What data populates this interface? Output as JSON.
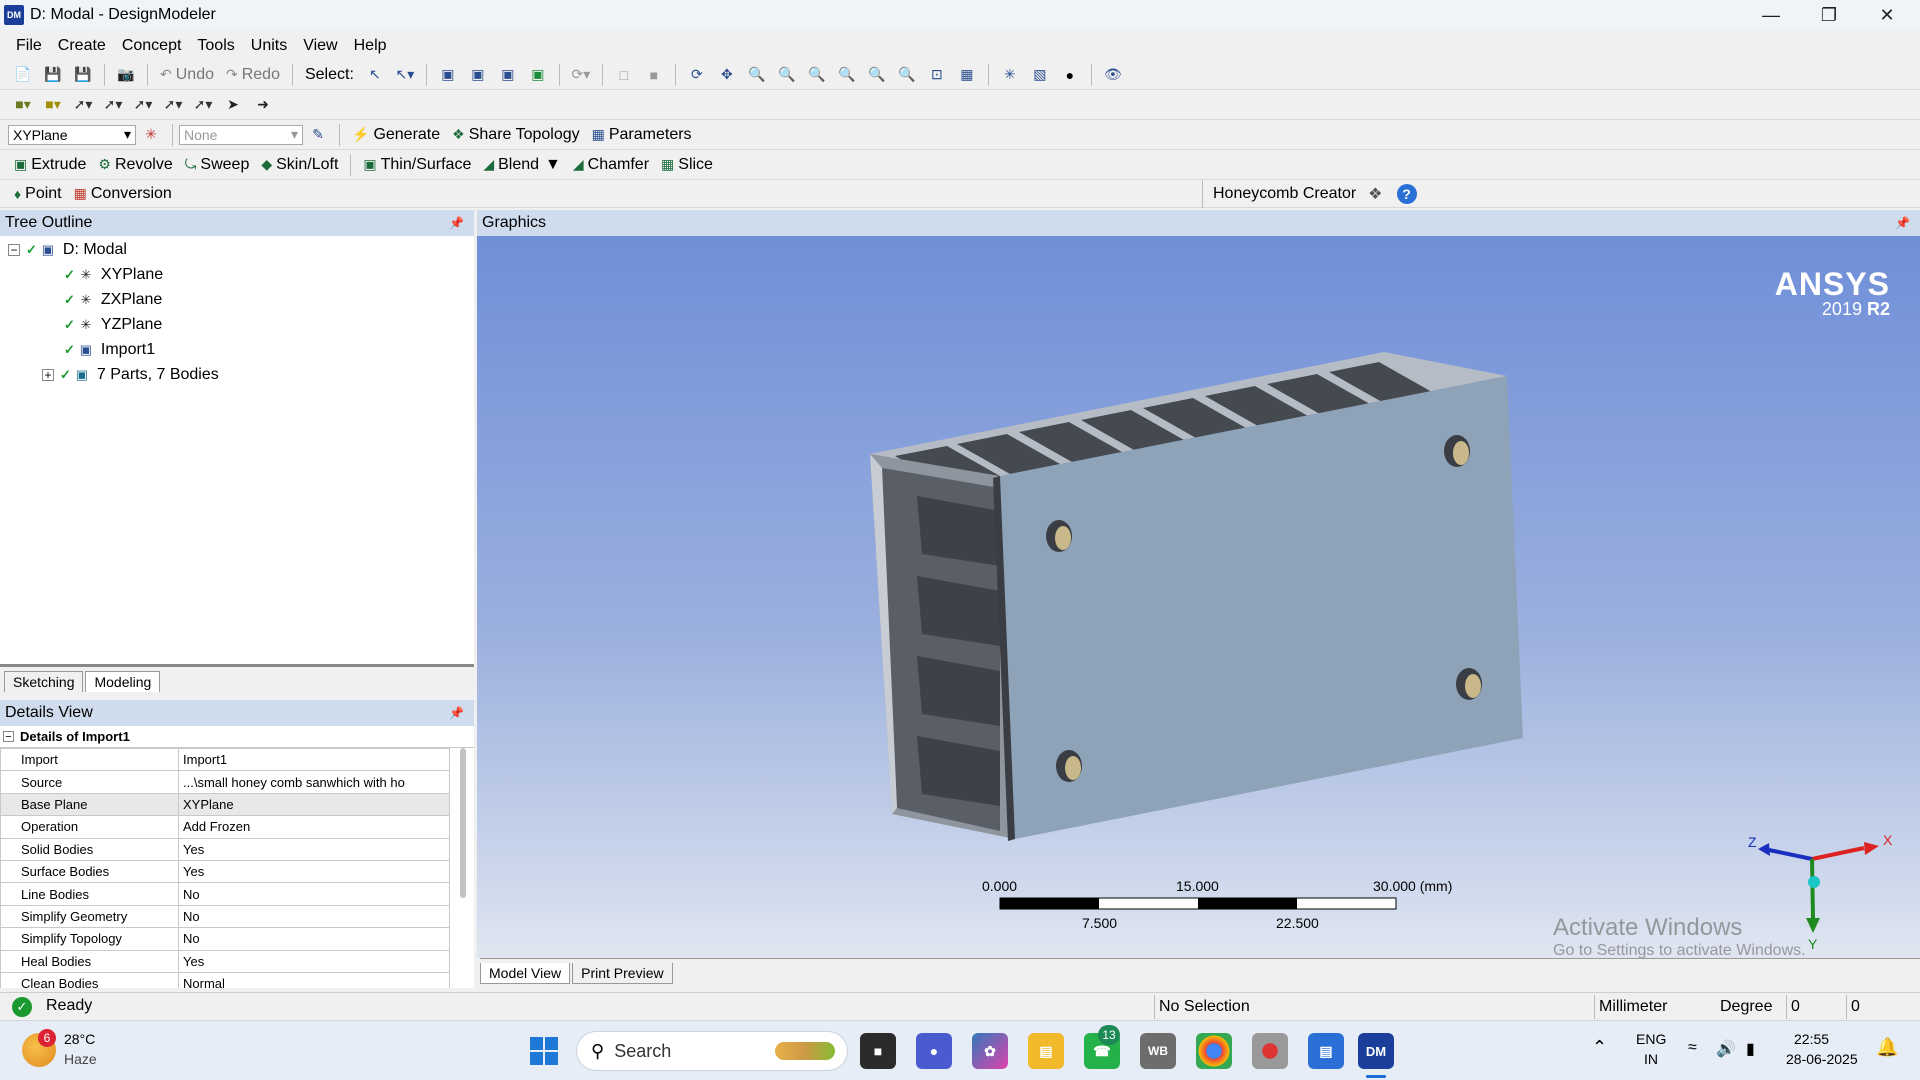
{
  "window": {
    "title": "D: Modal - DesignModeler",
    "app_icon": "DM"
  },
  "menu": [
    "File",
    "Create",
    "Concept",
    "Tools",
    "Units",
    "View",
    "Help"
  ],
  "toolbar1": {
    "undo": "Undo",
    "redo": "Redo",
    "select": "Select:"
  },
  "toolbar3": {
    "plane": "XYPlane",
    "sketch": "None",
    "generate": "Generate",
    "share_topology": "Share Topology",
    "parameters": "Parameters"
  },
  "toolbar4": {
    "extrude": "Extrude",
    "revolve": "Revolve",
    "sweep": "Sweep",
    "skin_loft": "Skin/Loft",
    "thin_surface": "Thin/Surface",
    "blend": "Blend",
    "chamfer": "Chamfer",
    "slice": "Slice"
  },
  "toolbar5": {
    "point": "Point",
    "conversion": "Conversion",
    "honeycomb": "Honeycomb Creator"
  },
  "tree": {
    "header": "Tree Outline",
    "root": "D: Modal",
    "items": [
      "XYPlane",
      "ZXPlane",
      "YZPlane",
      "Import1",
      "7 Parts, 7 Bodies"
    ],
    "tabs": [
      "Sketching",
      "Modeling"
    ]
  },
  "details": {
    "header": "Details View",
    "section": "Details of Import1",
    "rows": [
      [
        "Import",
        "Import1"
      ],
      [
        "Source",
        "...\\small honey comb sanwhich with ho"
      ],
      [
        "Base Plane",
        "XYPlane"
      ],
      [
        "Operation",
        "Add Frozen"
      ],
      [
        "Solid Bodies",
        "Yes"
      ],
      [
        "Surface Bodies",
        "Yes"
      ],
      [
        "Line Bodies",
        "No"
      ],
      [
        "Simplify Geometry",
        "No"
      ],
      [
        "Simplify Topology",
        "No"
      ],
      [
        "Heal Bodies",
        "Yes"
      ],
      [
        "Clean Bodies",
        "Normal"
      ]
    ]
  },
  "graphics": {
    "header": "Graphics",
    "logo_main": "ANSYS",
    "logo_version": "2019",
    "logo_release": "R2",
    "scale_labels_top": [
      "0.000",
      "15.000",
      "30.000 (mm)"
    ],
    "scale_labels_bottom": [
      "7.500",
      "22.500"
    ],
    "axis_x": "X",
    "axis_y": "Y",
    "axis_z": "Z",
    "watermark_title": "Activate Windows",
    "watermark_sub": "Go to Settings to activate Windows.",
    "tabs": [
      "Model View",
      "Print Preview"
    ]
  },
  "status": {
    "ready": "Ready",
    "selection": "No Selection",
    "length_unit": "Millimeter",
    "angle_unit": "Degree",
    "v1": "0",
    "v2": "0"
  },
  "taskbar": {
    "weather_temp": "28°C",
    "weather_desc": "Haze",
    "weather_badge": "6",
    "search": "Search",
    "whatsapp_badge": "13",
    "lang1": "ENG",
    "lang2": "IN",
    "time": "22:55",
    "date": "28-06-2025"
  },
  "colors": {
    "accent": "#1a3e9a",
    "panel_header": "#cfdced",
    "graphics_top": "#6f8fd8",
    "graphics_bottom": "#e0e6f1"
  }
}
